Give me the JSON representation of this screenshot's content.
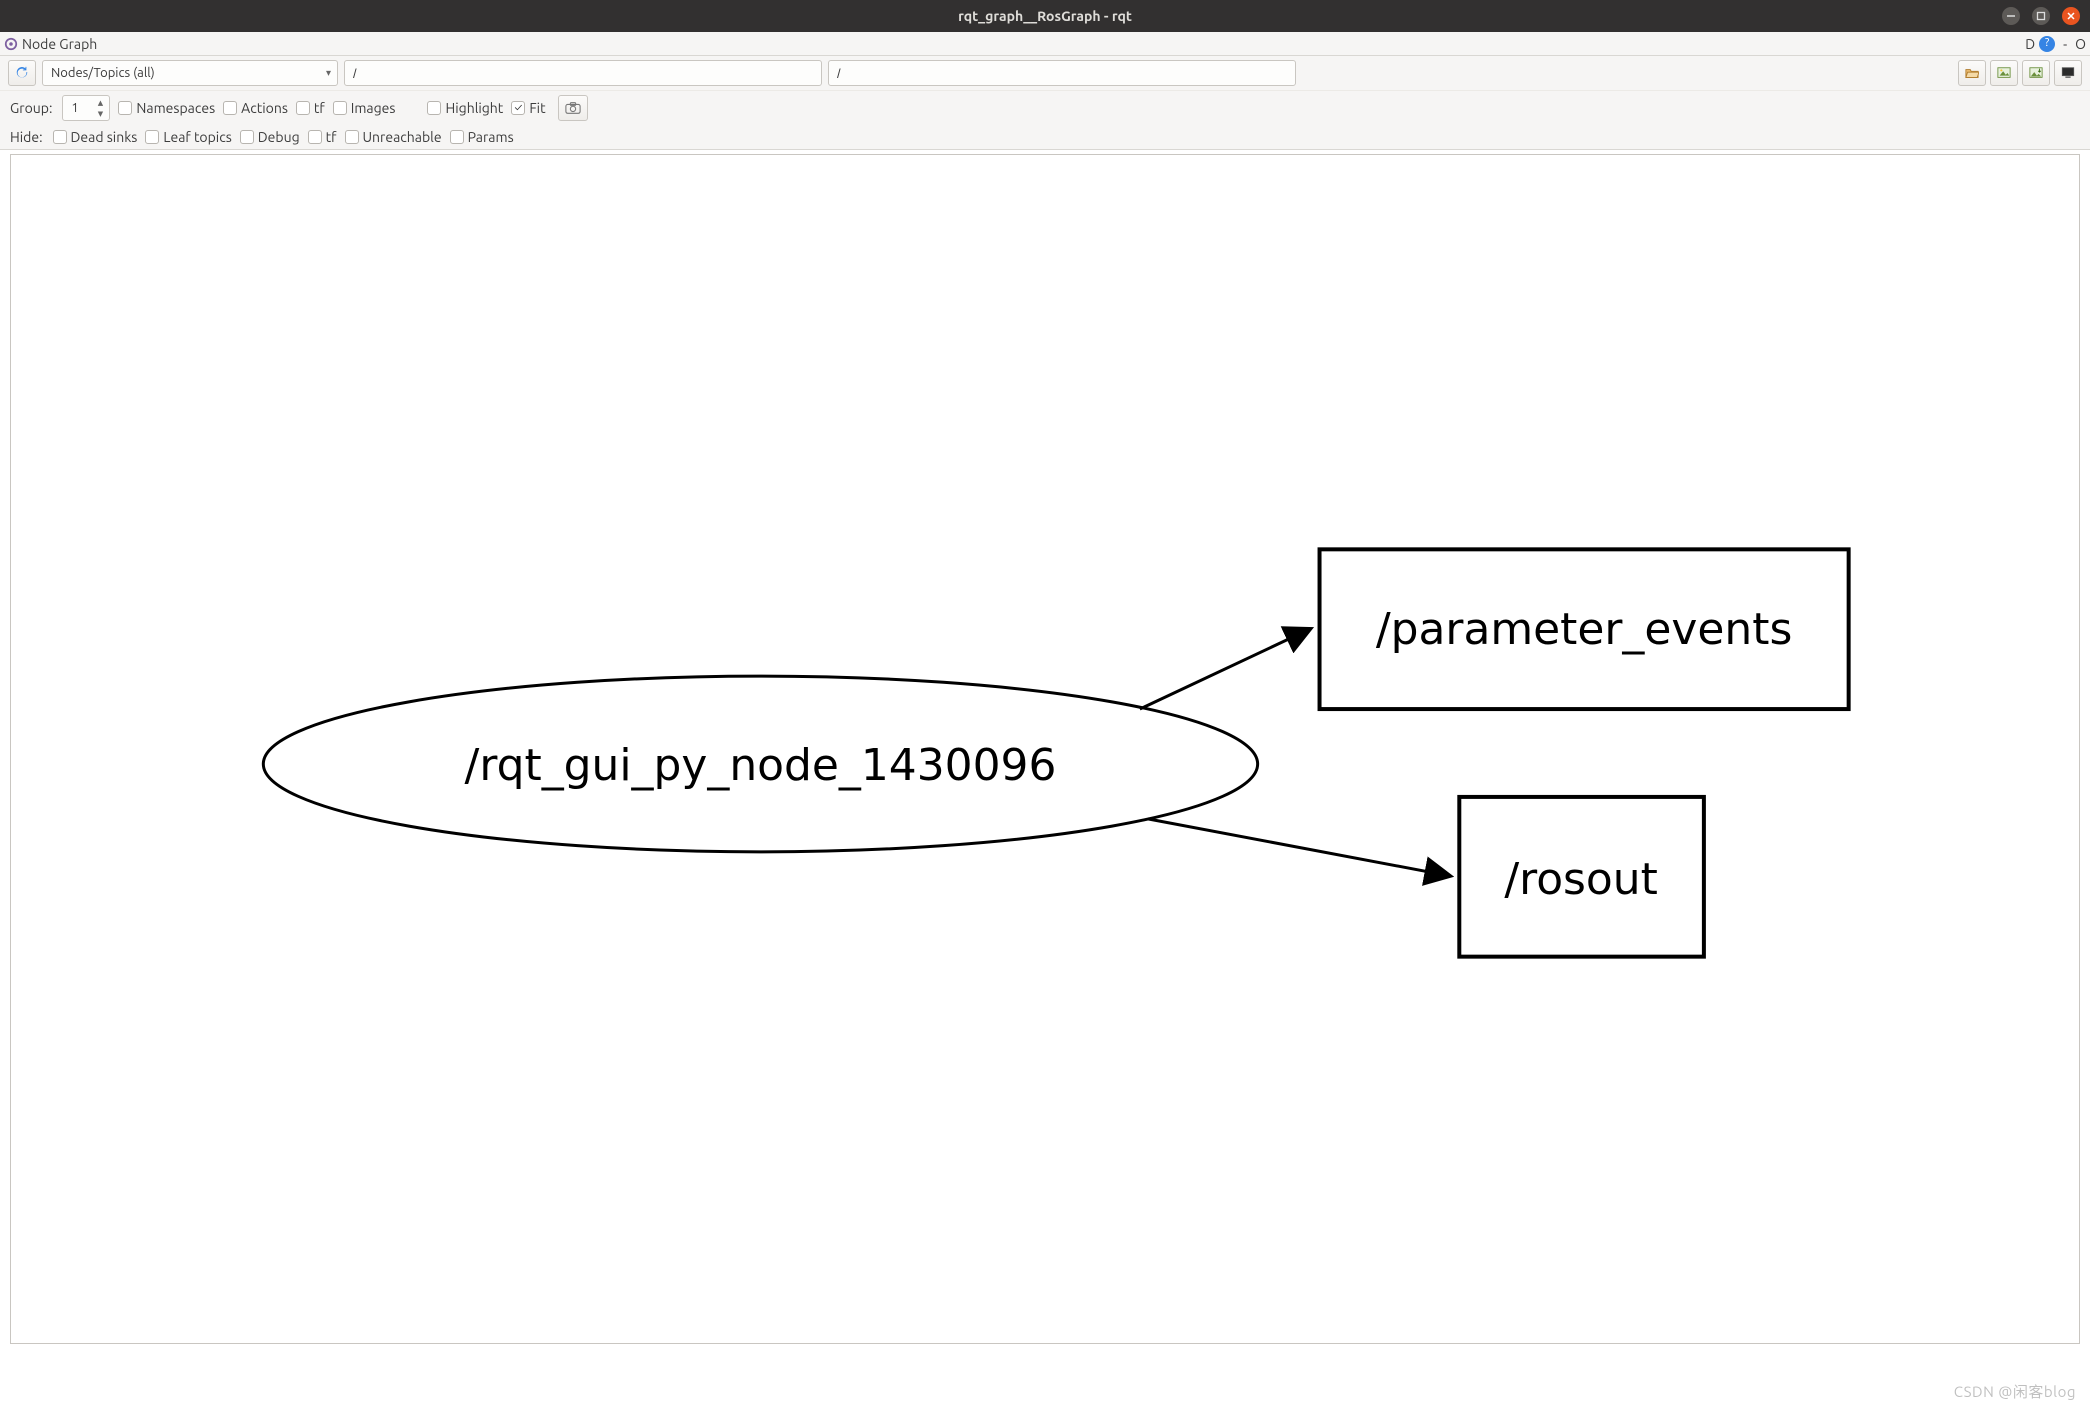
{
  "window": {
    "title": "rqt_graph__RosGraph - rqt",
    "plugin_title": "Node Graph",
    "label_D": "D",
    "help_badge": "?",
    "dash": "-",
    "O": "O"
  },
  "toolbar": {
    "refresh_tip": "Refresh",
    "combo_selected": "Nodes/Topics (all)",
    "filter1_value": "/",
    "filter2_value": "/"
  },
  "row2": {
    "group_label": "Group:",
    "group_value": "1",
    "chk_namespaces": "Namespaces",
    "chk_actions": "Actions",
    "chk_tf": "tf",
    "chk_images": "Images",
    "chk_highlight": "Highlight",
    "chk_fit": "Fit"
  },
  "row3": {
    "hide_label": "Hide:",
    "chk_deadsinks": "Dead sinks",
    "chk_leaftopics": "Leaf topics",
    "chk_debug": "Debug",
    "chk_tf": "tf",
    "chk_unreachable": "Unreachable",
    "chk_params": "Params"
  },
  "graph": {
    "node_label": "/rqt_gui_py_node_1430096",
    "topic1_label": "/parameter_events",
    "topic2_label": "/rosout"
  },
  "watermark": "CSDN @闲客blog"
}
